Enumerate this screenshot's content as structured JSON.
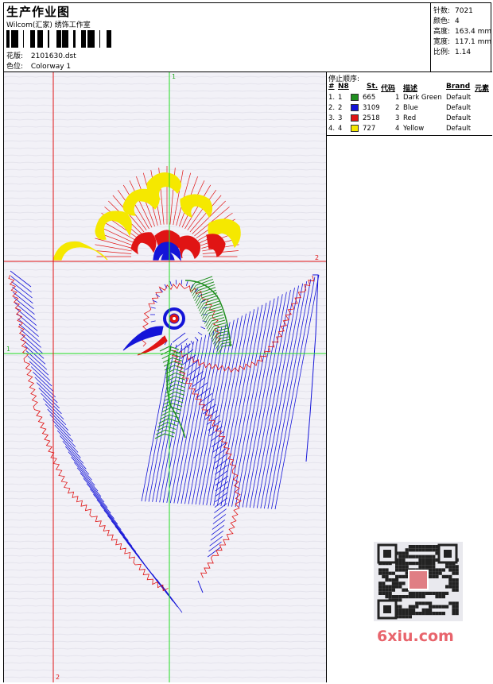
{
  "header": {
    "title": "生产作业图",
    "company": "Wilcom(汇家) 绣饰工作室",
    "design_label": "花版:",
    "design_value": "2101630.dst",
    "colorway_label": "色位:",
    "colorway_value": "Colorway 1"
  },
  "stats": {
    "stitches_label": "针数:",
    "stitches_value": "7021",
    "colors_label": "颜色:",
    "colors_value": "4",
    "height_label": "高度:",
    "height_value": "163.4 mm",
    "width_label": "宽度:",
    "width_value": "117.1 mm",
    "scale_label": "比例:",
    "scale_value": "1.14"
  },
  "stop_sequence": {
    "title": "停止顺序:",
    "headers": {
      "hash": "#",
      "no": "N8",
      "st": "St.",
      "code": "代码",
      "desc": "描述",
      "brand": "Brand",
      "elem": "元素"
    },
    "rows": [
      {
        "idx": "1.",
        "no": "1",
        "color": "#1f8f1f",
        "st": "665",
        "code": "1",
        "desc": "Dark Green",
        "brand": "Default"
      },
      {
        "idx": "2.",
        "no": "2",
        "color": "#1414d8",
        "st": "3109",
        "code": "2",
        "desc": "Blue",
        "brand": "Default"
      },
      {
        "idx": "3.",
        "no": "3",
        "color": "#e01414",
        "st": "2518",
        "code": "3",
        "desc": "Red",
        "brand": "Default"
      },
      {
        "idx": "4.",
        "no": "4",
        "color": "#f5e800",
        "st": "727",
        "code": "4",
        "desc": "Yellow",
        "brand": "Default"
      }
    ]
  },
  "canvas": {
    "guide_green_label": "1",
    "guide_red_h_label": "2",
    "guide_red_v_label": "2",
    "guide_green_h_label": "1",
    "thread_colors": {
      "green": "#1f8f1f",
      "blue": "#1414d8",
      "red": "#e01414",
      "yellow": "#f5e800"
    }
  },
  "watermark": {
    "site": "6xiu.com"
  }
}
